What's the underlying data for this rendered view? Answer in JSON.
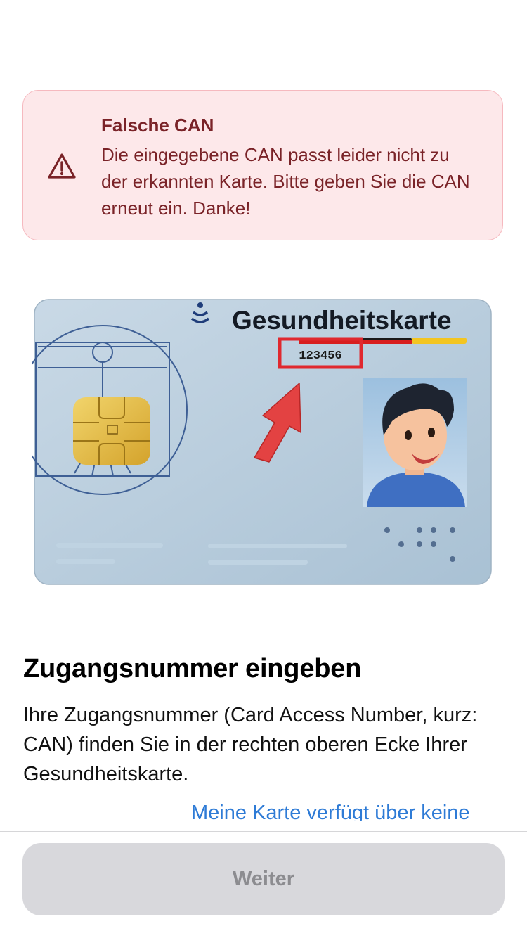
{
  "alert": {
    "title": "Falsche CAN",
    "message": "Die eingegebene CAN passt leider nicht zu der erkannten Karte. Bitte geben Sie die CAN erneut ein. Danke!",
    "icon": "warning-triangle-icon"
  },
  "card": {
    "title": "Gesundheitskarte",
    "can_number": "123456"
  },
  "content": {
    "heading": "Zugangsnummer eingeben",
    "description": "Ihre Zugangsnummer (Card Access Number, kurz: CAN) finden Sie in der rechten oberen Ecke Ihrer Gesundheitskarte.",
    "link_text": "Meine Karte verfügt über keine"
  },
  "footer": {
    "button_label": "Weiter"
  },
  "colors": {
    "alert_bg": "#fde8ea",
    "alert_text": "#7a2328",
    "link": "#2e7bd6",
    "button_disabled_bg": "#d8d8dc",
    "button_disabled_text": "#8c8c90"
  }
}
